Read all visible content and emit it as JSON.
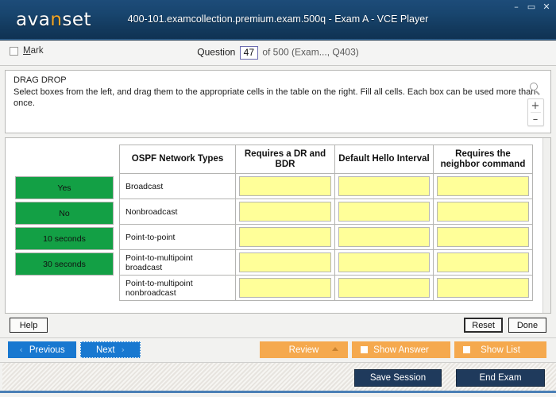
{
  "window": {
    "title": "400-101.examcollection.premium.exam.500q - Exam A - VCE Player",
    "logo_main_a": "ava",
    "logo_accent": "n",
    "logo_main_b": "set",
    "minimize": "–",
    "maximize": "▭",
    "close": "✕"
  },
  "question_bar": {
    "mark_label_first": "M",
    "mark_label_rest": "ark",
    "prefix": "Question",
    "number": "47",
    "suffix": "of 500 (Exam..., Q403)"
  },
  "stem": {
    "type_label": "DRAG DROP",
    "instructions": "Select boxes from the left, and drag them to the appropriate cells in the table on the right. Fill all cells. Each box can be used more than once.",
    "zoom_in": "+",
    "zoom_out": "–"
  },
  "drag_sources": [
    {
      "label": "Yes"
    },
    {
      "label": "No"
    },
    {
      "label": "10 seconds"
    },
    {
      "label": "30 seconds"
    }
  ],
  "table": {
    "headers": [
      "OSPF Network Types",
      "Requires a DR and BDR",
      "Default Hello Interval",
      "Requires the neighbor command"
    ],
    "rows": [
      {
        "label": "Broadcast",
        "cells": [
          "",
          "",
          ""
        ]
      },
      {
        "label": "Nonbroadcast",
        "cells": [
          "",
          "",
          ""
        ]
      },
      {
        "label": "Point-to-point",
        "cells": [
          "",
          "",
          ""
        ]
      },
      {
        "label": "Point-to-multipoint broadcast",
        "cells": [
          "",
          "",
          ""
        ]
      },
      {
        "label": "Point-to-multipoint nonbroadcast",
        "cells": [
          "",
          "",
          ""
        ]
      }
    ]
  },
  "actions": {
    "help": "Help",
    "reset": "Reset",
    "done": "Done"
  },
  "nav": {
    "previous": "Previous",
    "next": "Next",
    "review": "Review",
    "show_answer": "Show Answer",
    "show_list": "Show List",
    "chevron_left": "‹",
    "chevron_right": "›"
  },
  "bottom": {
    "save_session": "Save Session",
    "end_exam": "End Exam"
  },
  "colors": {
    "titlebar": "#18456e",
    "accent_orange": "#f5a623",
    "drag_green": "#13a045",
    "dropzone_yellow": "#ffff99",
    "nav_blue": "#1878d0",
    "orange_button": "#f5a94e",
    "dark_button": "#1f3a5c"
  }
}
